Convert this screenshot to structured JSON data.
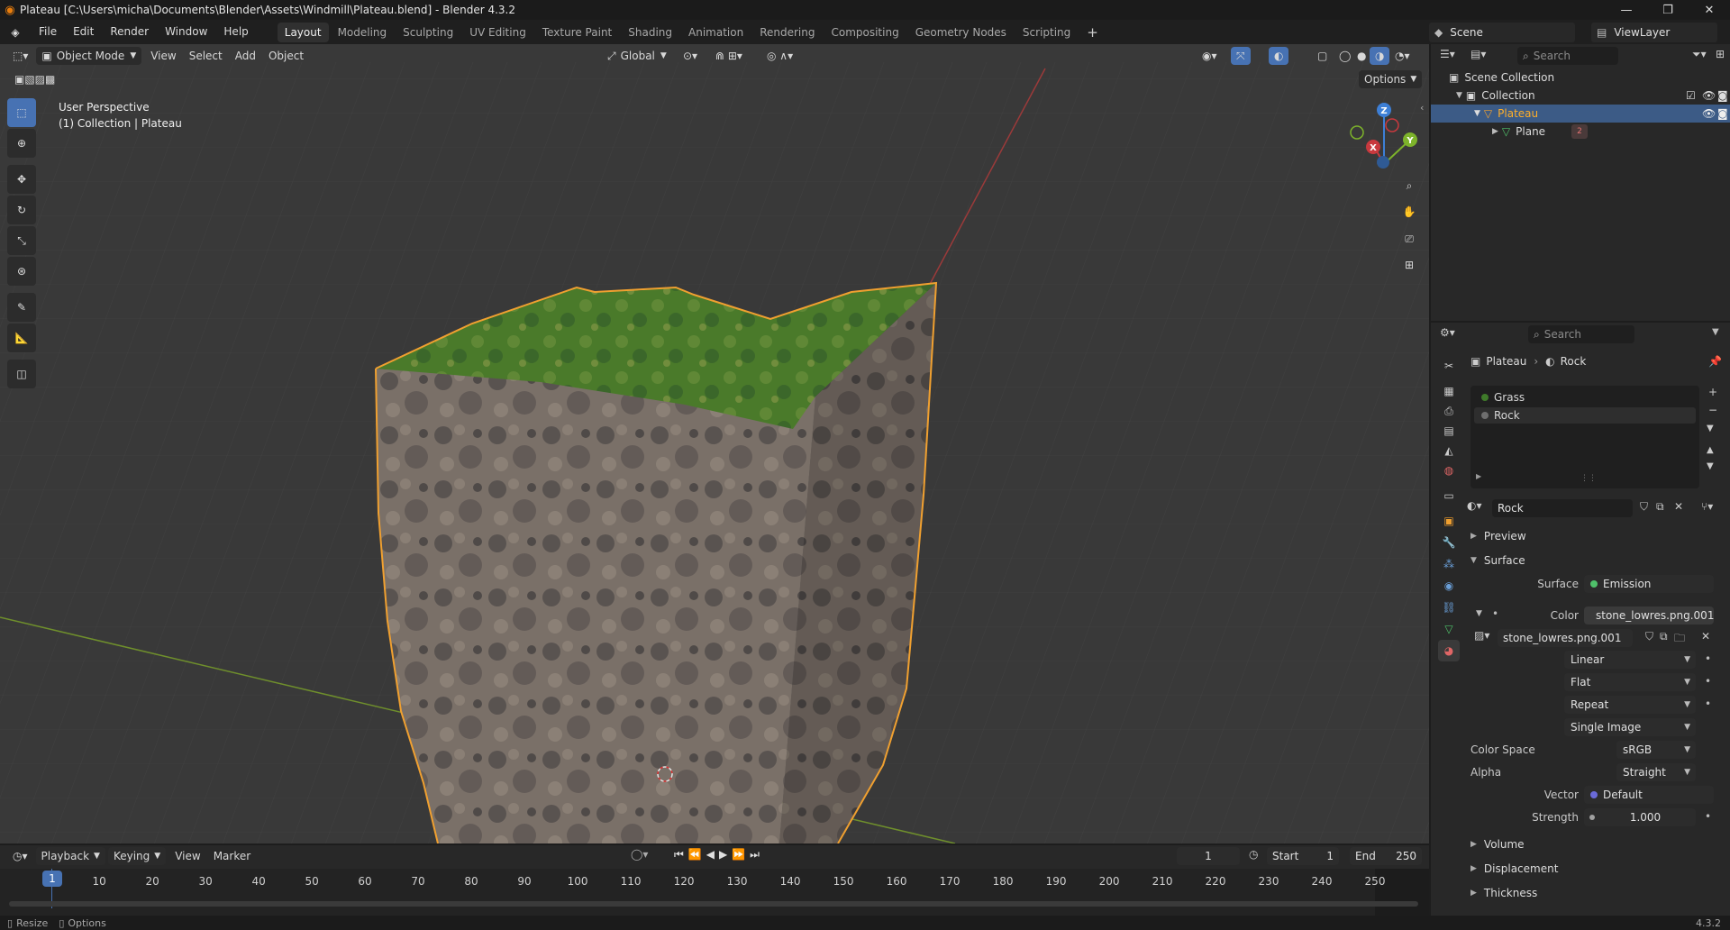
{
  "window": {
    "title": "Plateau [C:\\Users\\micha\\Documents\\Blender\\Assets\\Windmill\\Plateau.blend] - Blender 4.3.2"
  },
  "menu": [
    "File",
    "Edit",
    "Render",
    "Window",
    "Help"
  ],
  "workspaces": [
    "Layout",
    "Modeling",
    "Sculpting",
    "UV Editing",
    "Texture Paint",
    "Shading",
    "Animation",
    "Rendering",
    "Compositing",
    "Geometry Nodes",
    "Scripting"
  ],
  "active_workspace": "Layout",
  "scene": {
    "name": "Scene",
    "view_layer": "ViewLayer"
  },
  "viewport": {
    "mode": "Object Mode",
    "menus": [
      "View",
      "Select",
      "Add",
      "Object"
    ],
    "transform_orientation": "Global",
    "options_label": "Options",
    "overlay_line1": "User Perspective",
    "overlay_line2": "(1) Collection | Plateau",
    "gizmo": {
      "x": "X",
      "y": "Y",
      "z": "Z"
    }
  },
  "outliner": {
    "search_placeholder": "Search",
    "items": [
      {
        "label": "Scene Collection"
      },
      {
        "label": "Collection"
      },
      {
        "label": "Plateau"
      },
      {
        "label": "Plane"
      }
    ],
    "plane_badge": "2"
  },
  "properties": {
    "search_placeholder": "Search",
    "breadcrumb": [
      "Plateau",
      "Rock"
    ],
    "material_slots": [
      {
        "name": "Grass",
        "color": "#3f7a2a"
      },
      {
        "name": "Rock",
        "color": "#6e6e6e"
      }
    ],
    "material_name": "Rock",
    "sections": {
      "preview": "Preview",
      "surface": "Surface",
      "volume": "Volume",
      "displacement": "Displacement",
      "thickness": "Thickness"
    },
    "surface_label": "Surface",
    "surface_value": "Emission",
    "color_label": "Color",
    "color_value": "stone_lowres.png.001",
    "image_name": "stone_lowres.png.001",
    "interpolation": "Linear",
    "projection": "Flat",
    "extension": "Repeat",
    "source": "Single Image",
    "color_space_label": "Color Space",
    "color_space_value": "sRGB",
    "alpha_label": "Alpha",
    "alpha_value": "Straight",
    "vector_label": "Vector",
    "vector_value": "Default",
    "strength_label": "Strength",
    "strength_value": "1.000"
  },
  "timeline": {
    "menus": [
      "Playback",
      "Keying",
      "View",
      "Marker"
    ],
    "current_frame": "1",
    "start_label": "Start",
    "start_value": "1",
    "end_label": "End",
    "end_value": "250",
    "ticks": [
      "1",
      "10",
      "20",
      "30",
      "40",
      "50",
      "60",
      "70",
      "80",
      "90",
      "100",
      "110",
      "120",
      "130",
      "140",
      "150",
      "160",
      "170",
      "180",
      "190",
      "200",
      "210",
      "220",
      "230",
      "240",
      "250"
    ]
  },
  "statusbar": {
    "left1": "Resize",
    "left2": "Options",
    "version": "4.3.2"
  },
  "colors": {
    "accent": "#4772b3",
    "selection_outline": "#f0a030",
    "grass": "#4a7a2a",
    "rock": "#7a7068"
  }
}
